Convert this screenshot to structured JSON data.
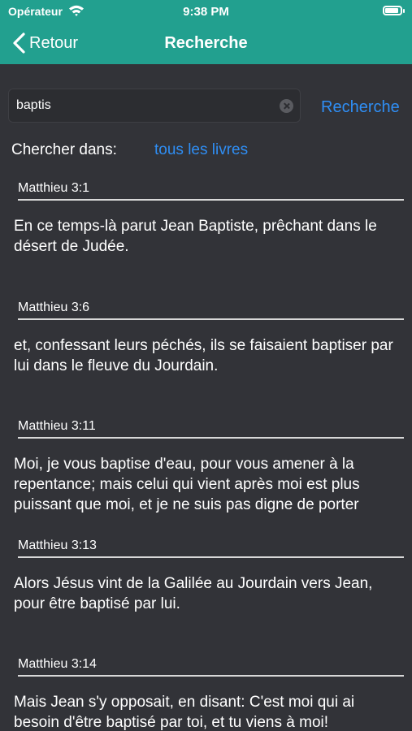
{
  "status_bar": {
    "carrier": "Opérateur",
    "time": "9:38 PM",
    "battery_level": 0.9
  },
  "nav": {
    "back_label": "Retour",
    "title": "Recherche"
  },
  "search": {
    "value": "baptis",
    "button_label": "Recherche"
  },
  "scope": {
    "label": "Chercher dans:",
    "value": "tous les livres"
  },
  "results": [
    {
      "ref": "Matthieu 3:1",
      "text": "En ce temps-là parut Jean Baptiste, prêchant dans le désert de Judée."
    },
    {
      "ref": "Matthieu 3:6",
      "text": "et, confessant leurs péchés, ils se faisaient baptiser par lui dans le fleuve du Jourdain."
    },
    {
      "ref": "Matthieu 3:11",
      "text": "Moi, je vous baptise d'eau, pour vous amener à la repentance; mais celui qui vient après moi est plus puissant que moi, et je ne suis pas digne de porter"
    },
    {
      "ref": "Matthieu 3:13",
      "text": "Alors Jésus vint de la Galilée au Jourdain vers Jean, pour être baptisé par lui."
    },
    {
      "ref": "Matthieu 3:14",
      "text": "Mais Jean s'y opposait, en disant: C'est moi qui ai besoin d'être baptisé par toi, et tu viens à moi!"
    }
  ],
  "colors": {
    "header": "#22a08f",
    "background": "#323338",
    "accent": "#2f8ef4"
  }
}
